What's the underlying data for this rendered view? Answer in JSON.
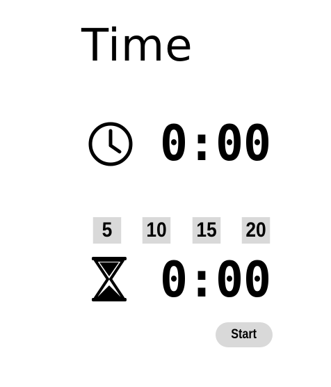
{
  "title": "Time",
  "clock": {
    "icon": "clock-icon",
    "display": "0:00"
  },
  "timer": {
    "icon": "hourglass-icon",
    "display": "0:00",
    "presets": [
      "5",
      "10",
      "15",
      "20"
    ],
    "start_label": "Start"
  },
  "colors": {
    "text": "#000000",
    "button_bg": "#d9d9d9",
    "background": "#ffffff"
  }
}
